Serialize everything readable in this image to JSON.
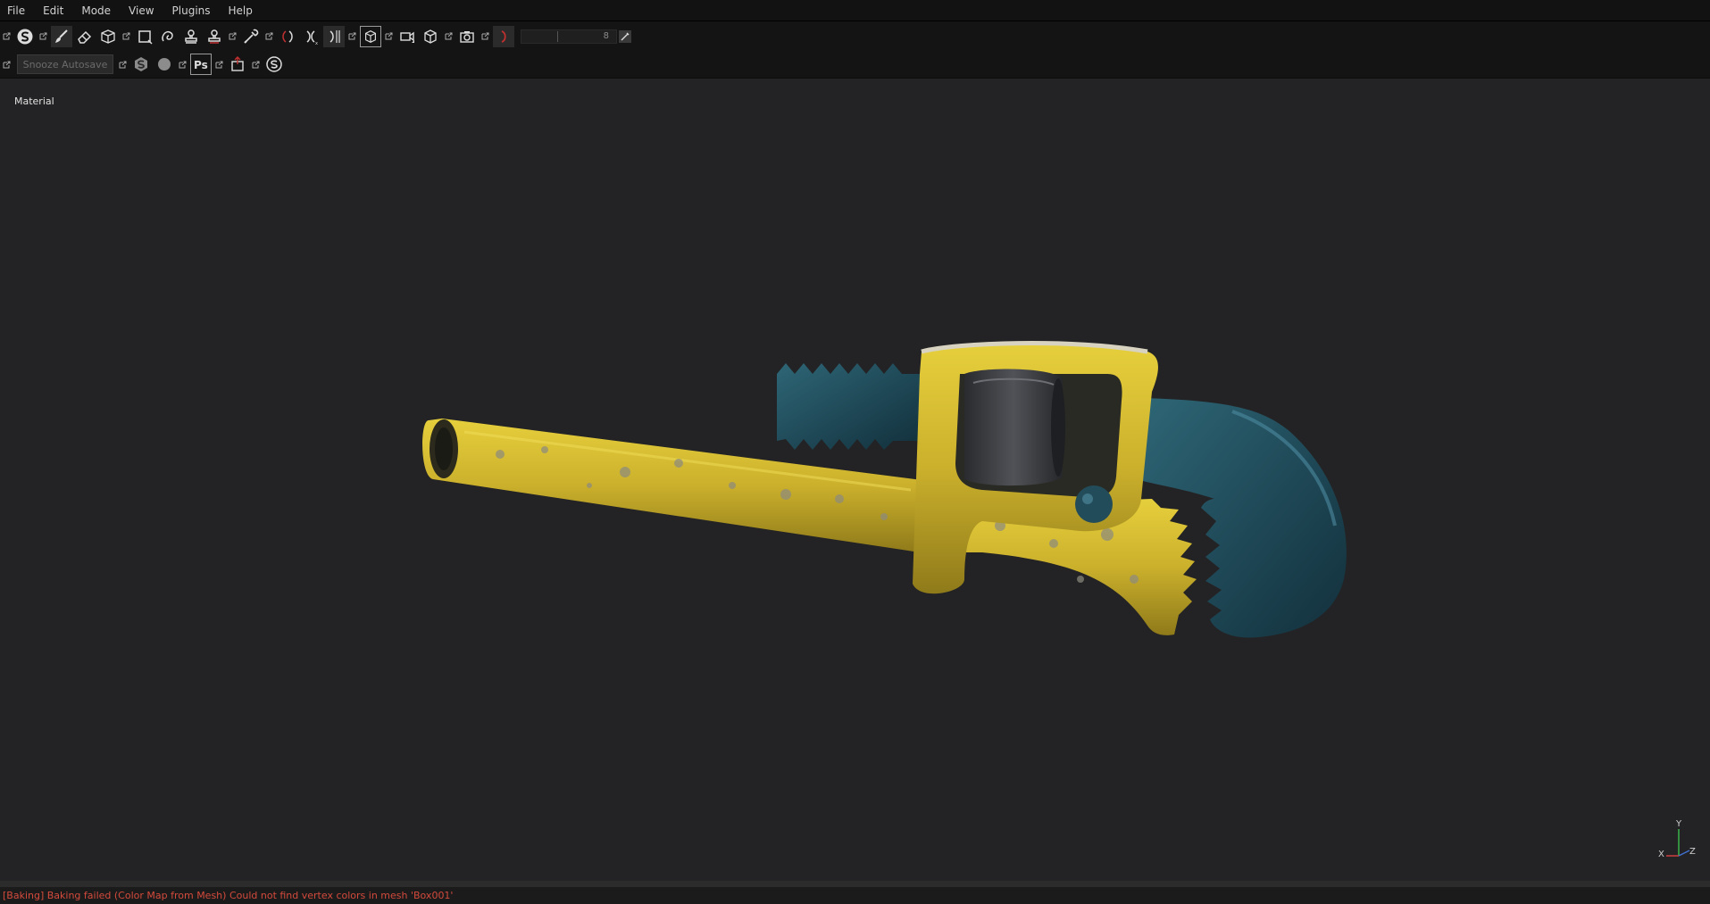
{
  "menu": {
    "items": [
      {
        "label": "File"
      },
      {
        "label": "Edit"
      },
      {
        "label": "Mode"
      },
      {
        "label": "View"
      },
      {
        "label": "Plugins"
      },
      {
        "label": "Help"
      }
    ]
  },
  "toolbar": {
    "tools": [
      "substance-logo-icon",
      "paint-brush-icon",
      "eraser-icon",
      "projection-icon",
      "polygon-fill-icon",
      "smudge-icon",
      "clone-stamp-icon",
      "clone-stamp-alt-icon",
      "color-picker-icon",
      "symmetry-icon",
      "mirror-x-icon",
      "mirror-y-icon",
      "camera-view-icon",
      "video-camera-icon",
      "cube-view-icon",
      "screenshot-camera-icon",
      "light-ring-icon"
    ],
    "slider_value": "8",
    "snooze_label": "Snooze Autosave"
  },
  "toolbar2_icons": [
    "substance-s-icon",
    "sphere-icon",
    "photoshop-icon",
    "export-icon",
    "substance-share-icon"
  ],
  "viewport": {
    "mode_label": "Material",
    "axis": {
      "y": "Y",
      "x": "X",
      "z": "Z"
    }
  },
  "status": {
    "message": "[Baking] Baking failed (Color Map from Mesh) Could not find vertex colors in mesh 'Box001'"
  },
  "colors": {
    "menubar_bg": "#121212",
    "viewport_bg": "#232325",
    "error_text": "#d44a3c",
    "wrench_yellow": "#c9b02a",
    "wrench_teal": "#1f4a58",
    "roller_gray": "#3a3b3e"
  }
}
